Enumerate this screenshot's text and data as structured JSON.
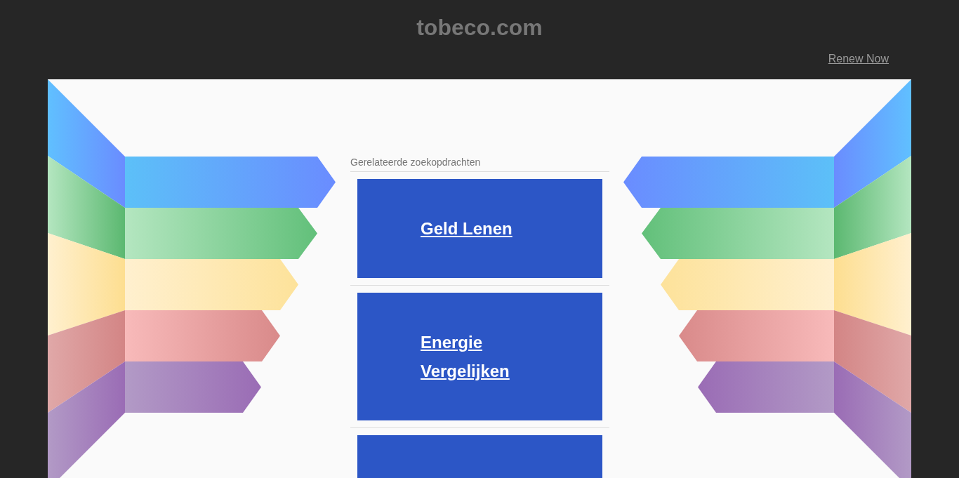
{
  "header": {
    "title": "tobeco.com",
    "renew_link": "Renew Now"
  },
  "related": {
    "heading": "Gerelateerde zoekopdrachten",
    "items": [
      {
        "kind": "link",
        "title": "Geld Lenen"
      },
      {
        "kind": "link",
        "title": "Energie Vergelijken"
      },
      {
        "kind": "blank"
      }
    ]
  }
}
